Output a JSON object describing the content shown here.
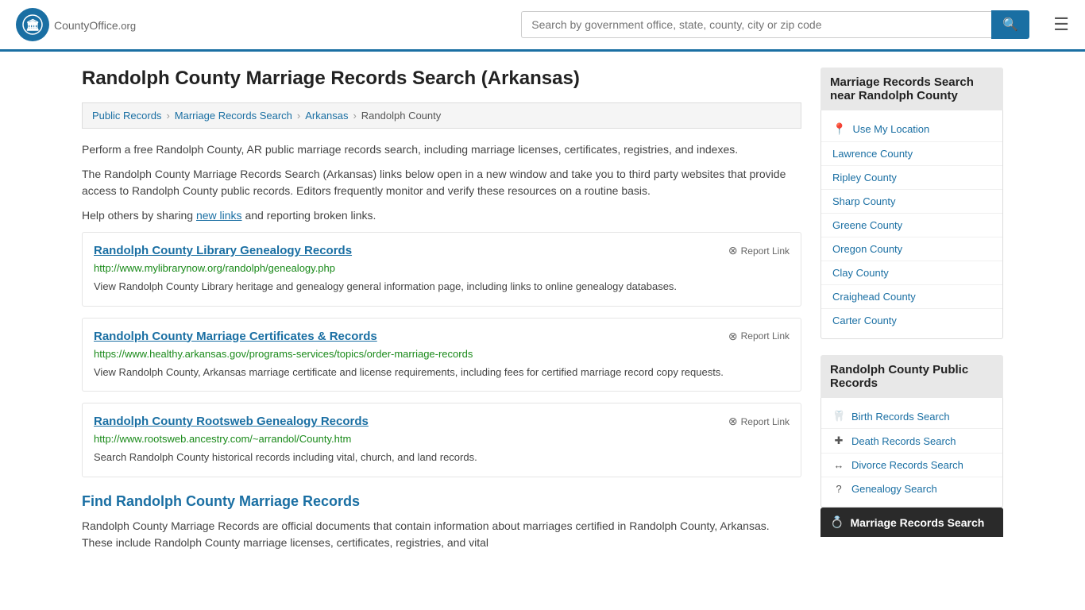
{
  "header": {
    "logo_text": "CountyOffice",
    "logo_suffix": ".org",
    "search_placeholder": "Search by government office, state, county, city or zip code",
    "search_value": ""
  },
  "page": {
    "title": "Randolph County Marriage Records Search (Arkansas)",
    "breadcrumbs": [
      {
        "label": "Public Records",
        "href": "#"
      },
      {
        "label": "Marriage Records Search",
        "href": "#"
      },
      {
        "label": "Arkansas",
        "href": "#"
      },
      {
        "label": "Randolph County",
        "href": "#"
      }
    ],
    "description1": "Perform a free Randolph County, AR public marriage records search, including marriage licenses, certificates, registries, and indexes.",
    "description2": "The Randolph County Marriage Records Search (Arkansas) links below open in a new window and take you to third party websites that provide access to Randolph County public records. Editors frequently monitor and verify these resources on a routine basis.",
    "description3_prefix": "Help others by sharing ",
    "description3_link": "new links",
    "description3_suffix": " and reporting broken links.",
    "records": [
      {
        "title": "Randolph County Library Genealogy Records",
        "report_label": "Report Link",
        "url": "http://www.mylibrarynow.org/randolph/genealogy.php",
        "description": "View Randolph County Library heritage and genealogy general information page, including links to online genealogy databases."
      },
      {
        "title": "Randolph County Marriage Certificates & Records",
        "report_label": "Report Link",
        "url": "https://www.healthy.arkansas.gov/programs-services/topics/order-marriage-records",
        "description": "View Randolph County, Arkansas marriage certificate and license requirements, including fees for certified marriage record copy requests."
      },
      {
        "title": "Randolph County Rootsweb Genealogy Records",
        "report_label": "Report Link",
        "url": "http://www.rootsweb.ancestry.com/~arrandol/County.htm",
        "description": "Search Randolph County historical records including vital, church, and land records."
      }
    ],
    "find_section_title": "Find Randolph County Marriage Records",
    "find_description": "Randolph County Marriage Records are official documents that contain information about marriages certified in Randolph County, Arkansas. These include Randolph County marriage licenses, certificates, registries, and vital"
  },
  "sidebar": {
    "nearby_header": "Marriage Records Search near Randolph County",
    "use_my_location": "Use My Location",
    "nearby_counties": [
      "Lawrence County",
      "Ripley County",
      "Sharp County",
      "Greene County",
      "Oregon County",
      "Clay County",
      "Craighead County",
      "Carter County"
    ],
    "public_records_header": "Randolph County Public Records",
    "public_records": [
      {
        "icon": "🦷",
        "label": "Birth Records Search"
      },
      {
        "icon": "+",
        "label": "Death Records Search"
      },
      {
        "icon": "↔",
        "label": "Divorce Records Search"
      },
      {
        "icon": "?",
        "label": "Genealogy Search"
      },
      {
        "icon": "💍",
        "label": "Marriage Records Search"
      }
    ]
  }
}
